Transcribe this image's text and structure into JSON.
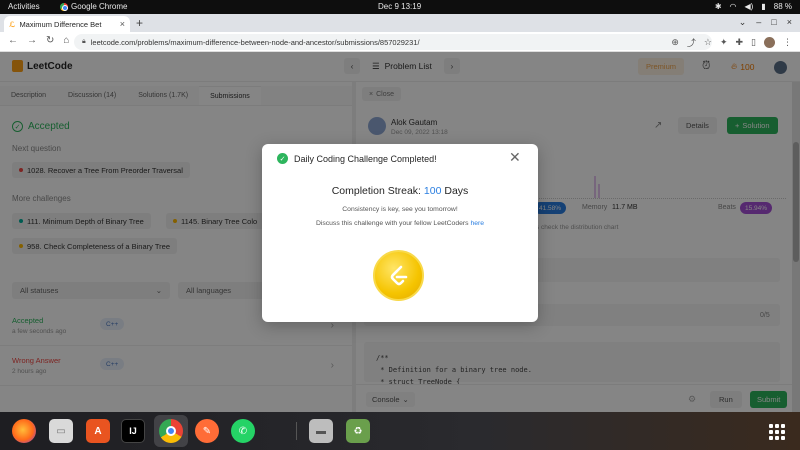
{
  "system": {
    "activities": "Activities",
    "app_name": "Google Chrome",
    "clock": "Dec 9  13:19",
    "battery": "88 %"
  },
  "browser": {
    "tab_title": "Maximum Difference Bet",
    "url": "leetcode.com/problems/maximum-difference-between-node-and-ancestor/submissions/857029231/"
  },
  "header": {
    "logo": "LeetCode",
    "problem_list": "Problem List",
    "premium": "Premium",
    "streak": "100"
  },
  "left": {
    "tabs": [
      "Description",
      "Discussion (14)",
      "Solutions (1.7K)",
      "Submissions"
    ],
    "accepted": "Accepted",
    "next_question_label": "Next question",
    "next_question": "1028. Recover a Tree From Preorder Traversal",
    "more_label": "More challenges",
    "challenges": [
      "111. Minimum Depth of Binary Tree",
      "1145. Binary Tree Colo",
      "958. Check Completeness of a Binary Tree"
    ],
    "filter_status": "All statuses",
    "filter_lang": "All languages",
    "rows": [
      {
        "status": "Accepted",
        "time": "a few seconds ago",
        "lang": "C++"
      },
      {
        "status": "Wrong Answer",
        "time": "2 hours ago",
        "lang": "C++"
      }
    ]
  },
  "right": {
    "close": "Close",
    "author": "Alok Gautam",
    "date": "Dec 09, 2022 13:18",
    "details": "Details",
    "solution": "Solution",
    "beats_left": "41.58%",
    "memory_label": "Memory",
    "memory_value": "11.7 MB",
    "beats_label": "Beats",
    "beats_right": "15.94%",
    "dist_text": "s check the distribution chart",
    "count": "0/5",
    "code": "/**\n * Definition for a binary tree node.\n * struct TreeNode {",
    "console": "Console",
    "run": "Run",
    "submit": "Submit"
  },
  "modal": {
    "title": "Daily Coding Challenge Completed!",
    "streak_label": "Completion Streak:",
    "streak_value": "100",
    "streak_unit": "Days",
    "line1": "Consistency is key, see you tomorrow!",
    "line2": "Discuss this challenge with your fellow LeetCoders",
    "link": "here"
  },
  "colors": {
    "accent_green": "#2db55d",
    "link_blue": "#2a7ee0",
    "badge_gold": "#f5c400",
    "leetcode_orange": "#ffa116"
  },
  "dock": {
    "icons": [
      "firefox-icon",
      "files-icon",
      "app-store-icon",
      "intellij-icon",
      "chrome-icon",
      "postman-icon",
      "whatsapp-icon",
      "drive-icon",
      "trash-icon",
      "show-apps-icon"
    ]
  }
}
